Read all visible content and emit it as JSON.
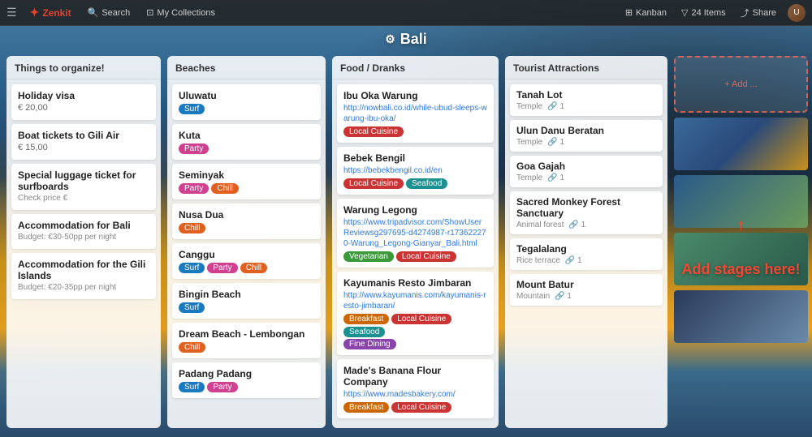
{
  "navbar": {
    "hamburger": "☰",
    "logo": "Zenkit",
    "search": "Search",
    "collections": "My Collections",
    "right_items": [
      "Kanban",
      "24 Items",
      "Share"
    ],
    "filter_icon": "▽"
  },
  "page": {
    "title": "Bali",
    "gear": "⚙"
  },
  "columns": [
    {
      "id": "things",
      "header": "Things to organize!",
      "cards": [
        {
          "title": "Holiday visa",
          "subtitle": "€ 20,00"
        },
        {
          "title": "Boat tickets to Gili Air",
          "subtitle": "€ 15,00"
        },
        {
          "title": "Special luggage ticket for surfboards",
          "meta": "Check price €"
        },
        {
          "title": "Accommodation for Bali",
          "meta": "Budget: €30-50pp per night"
        },
        {
          "title": "Accommodation for the Gili Islands",
          "meta": "Budget: €20-35pp per night"
        }
      ]
    },
    {
      "id": "beaches",
      "header": "Beaches",
      "cards": [
        {
          "title": "Uluwatu",
          "tags": [
            {
              "label": "Surf",
              "class": "tag-surf"
            }
          ]
        },
        {
          "title": "Kuta",
          "tags": [
            {
              "label": "Party",
              "class": "tag-party"
            }
          ]
        },
        {
          "title": "Seminyak",
          "tags": [
            {
              "label": "Party",
              "class": "tag-party"
            },
            {
              "label": "Chill",
              "class": "tag-chill"
            }
          ]
        },
        {
          "title": "Nusa Dua",
          "tags": [
            {
              "label": "Chill",
              "class": "tag-chill"
            }
          ]
        },
        {
          "title": "Canggu",
          "tags": [
            {
              "label": "Surf",
              "class": "tag-surf"
            },
            {
              "label": "Party",
              "class": "tag-party"
            },
            {
              "label": "Chill",
              "class": "tag-chill"
            }
          ]
        },
        {
          "title": "Bingin Beach",
          "tags": [
            {
              "label": "Surf",
              "class": "tag-surf"
            }
          ]
        },
        {
          "title": "Dream Beach - Lembongan",
          "tags": [
            {
              "label": "Chill",
              "class": "tag-chill"
            }
          ]
        },
        {
          "title": "Padang Padang",
          "tags": [
            {
              "label": "Surf",
              "class": "tag-surf"
            },
            {
              "label": "Party",
              "class": "tag-party"
            }
          ]
        }
      ]
    },
    {
      "id": "food",
      "header": "Food / Dranks",
      "cards": [
        {
          "title": "Ibu Oka Warung",
          "link": "http://nowbali.co.id/while-ubud-sleeps-warung-ibu-oka/",
          "tags": [
            {
              "label": "Local Cuisine",
              "class": "tag-local-cuisine"
            }
          ]
        },
        {
          "title": "Bebek Bengil",
          "link": "https://bebekbengil.co.id/en",
          "tags": [
            {
              "label": "Local Cuisine",
              "class": "tag-local-cuisine"
            },
            {
              "label": "Seafood",
              "class": "tag-seafood"
            }
          ]
        },
        {
          "title": "Warung Legong",
          "link": "https://www.tripadvisor.com/ShowUserReviewsg297695-d4274987-r173622270-Warung_Legong-Gianyar_Bali.html",
          "tags": [
            {
              "label": "Vegetarian",
              "class": "tag-vegetarian"
            },
            {
              "label": "Local Cuisine",
              "class": "tag-local-cuisine"
            }
          ]
        },
        {
          "title": "Kayumanis Resto Jimbaran",
          "link": "http://www.kayumanis.com/kayumanis-resto-jimbaran/",
          "tags": [
            {
              "label": "Breakfast",
              "class": "tag-breakfast"
            },
            {
              "label": "Local Cuisine",
              "class": "tag-local-cuisine"
            },
            {
              "label": "Seafood",
              "class": "tag-seafood"
            },
            {
              "label": "Fine Dining",
              "class": "tag-fine-dining"
            }
          ]
        },
        {
          "title": "Made's Banana Flour Company",
          "link": "https://www.madesbakery.com/",
          "tags": [
            {
              "label": "Breakfast",
              "class": "tag-breakfast"
            },
            {
              "label": "Local Cuisine",
              "class": "tag-local-cuisine"
            }
          ]
        }
      ]
    },
    {
      "id": "tourist",
      "header": "Tourist Attractions",
      "cards": [
        {
          "title": "Tanah Lot",
          "type": "Temple",
          "links": "1"
        },
        {
          "title": "Ulun Danu Beratan",
          "type": "Temple",
          "links": "1"
        },
        {
          "title": "Goa Gajah",
          "type": "Temple",
          "links": "1"
        },
        {
          "title": "Sacred Monkey Forest Sanctuary",
          "type": "Animal forest",
          "links": "1"
        },
        {
          "title": "Tegalalang",
          "type": "Rice terrace",
          "links": "1"
        },
        {
          "title": "Mount Batur",
          "type": "Mountain",
          "links": "1"
        }
      ]
    }
  ],
  "add_stages": {
    "button_label": "+ Add ...",
    "label": "Add stages here!"
  }
}
